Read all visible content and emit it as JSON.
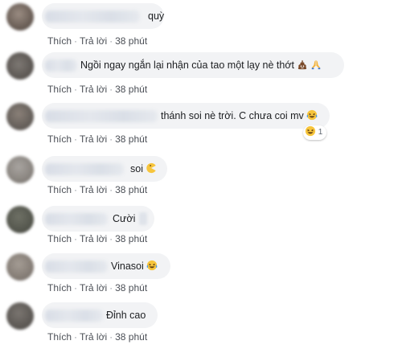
{
  "comments": [
    {
      "text": "quỳ",
      "actions": {
        "like": "Thích",
        "reply": "Trả lời",
        "time": "38 phút"
      },
      "emojis": []
    },
    {
      "text": "Ngồi ngay ngắn lại nhận của tao một lạy nè thớt",
      "actions": {
        "like": "Thích",
        "reply": "Trả lời",
        "time": "38 phút"
      },
      "emojis": [
        "poop-icon",
        "praying-hands-icon"
      ]
    },
    {
      "text": "thánh soi nè trời. C chưa coi mv",
      "actions": {
        "like": "Thích",
        "reply": "Trả lời",
        "time": "38 phút"
      },
      "emojis": [
        "laughing-icon"
      ],
      "reaction": {
        "icon": "haha-reaction-icon",
        "count": "1"
      }
    },
    {
      "text": "soi",
      "actions": {
        "like": "Thích",
        "reply": "Trả lời",
        "time": "38 phút"
      },
      "emojis": [
        "pacman-icon"
      ]
    },
    {
      "text": "Cười",
      "actions": {
        "like": "Thích",
        "reply": "Trả lời",
        "time": "38 phút"
      },
      "emojis": []
    },
    {
      "text": "Vinasoi",
      "actions": {
        "like": "Thích",
        "reply": "Trả lời",
        "time": "38 phút"
      },
      "emojis": [
        "laughing-icon"
      ]
    },
    {
      "text": "Đỉnh cao",
      "actions": {
        "like": "Thích",
        "reply": "Trả lời",
        "time": "38 phút"
      },
      "emojis": []
    }
  ]
}
